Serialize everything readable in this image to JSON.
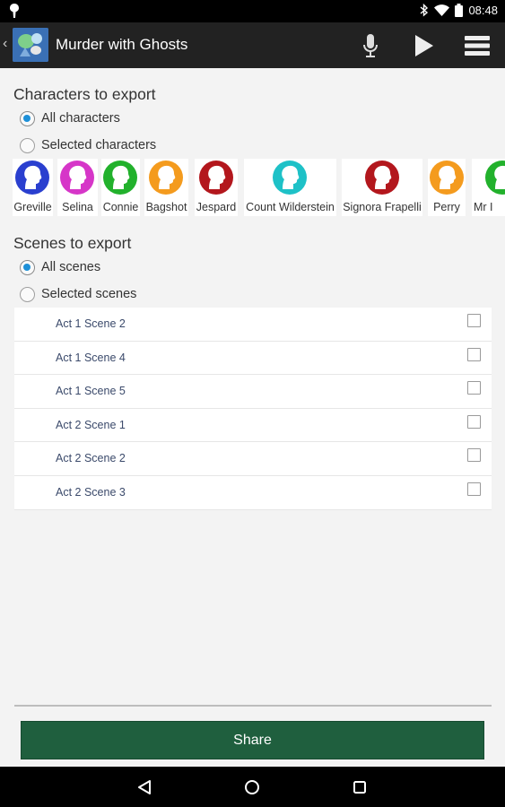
{
  "status_bar": {
    "time": "08:48"
  },
  "app": {
    "title": "Murder with Ghosts"
  },
  "characters_section": {
    "title": "Characters to export",
    "option_all": "All characters",
    "option_selected": "Selected characters",
    "selected_option": "all",
    "characters": [
      {
        "name": "Greville",
        "color": "#2a3fcf"
      },
      {
        "name": "Selina",
        "color": "#d636c8"
      },
      {
        "name": "Connie",
        "color": "#22b12c"
      },
      {
        "name": "Bagshot",
        "color": "#f49b1e"
      },
      {
        "name": "Jespard",
        "color": "#b3171d"
      },
      {
        "name": "Count Wilderstein",
        "color": "#1ec1c7"
      },
      {
        "name": "Signora Frapelli",
        "color": "#b3171d"
      },
      {
        "name": "Perry",
        "color": "#f49b1e"
      },
      {
        "name": "Mr I",
        "color": "#22b12c"
      }
    ]
  },
  "scenes_section": {
    "title": "Scenes to export",
    "option_all": "All scenes",
    "option_selected": "Selected scenes",
    "selected_option": "all",
    "scenes": [
      {
        "label": "Act 1 Scene 2",
        "checked": false
      },
      {
        "label": "Act 1 Scene 4",
        "checked": false
      },
      {
        "label": "Act 1 Scene 5",
        "checked": false
      },
      {
        "label": "Act 2 Scene 1",
        "checked": false
      },
      {
        "label": "Act 2 Scene 2",
        "checked": false
      },
      {
        "label": "Act 2 Scene 3",
        "checked": false
      }
    ]
  },
  "share_button": {
    "label": "Share"
  },
  "colors": {
    "share_button": "#1f5f3e",
    "radio_accent": "#1e90d8",
    "action_bar": "#222222"
  },
  "icons": [
    "location-pin-icon",
    "bluetooth-icon",
    "wifi-icon",
    "battery-icon",
    "microphone-icon",
    "play-icon",
    "menu-icon",
    "back-nav-icon",
    "home-nav-icon",
    "recents-nav-icon"
  ]
}
